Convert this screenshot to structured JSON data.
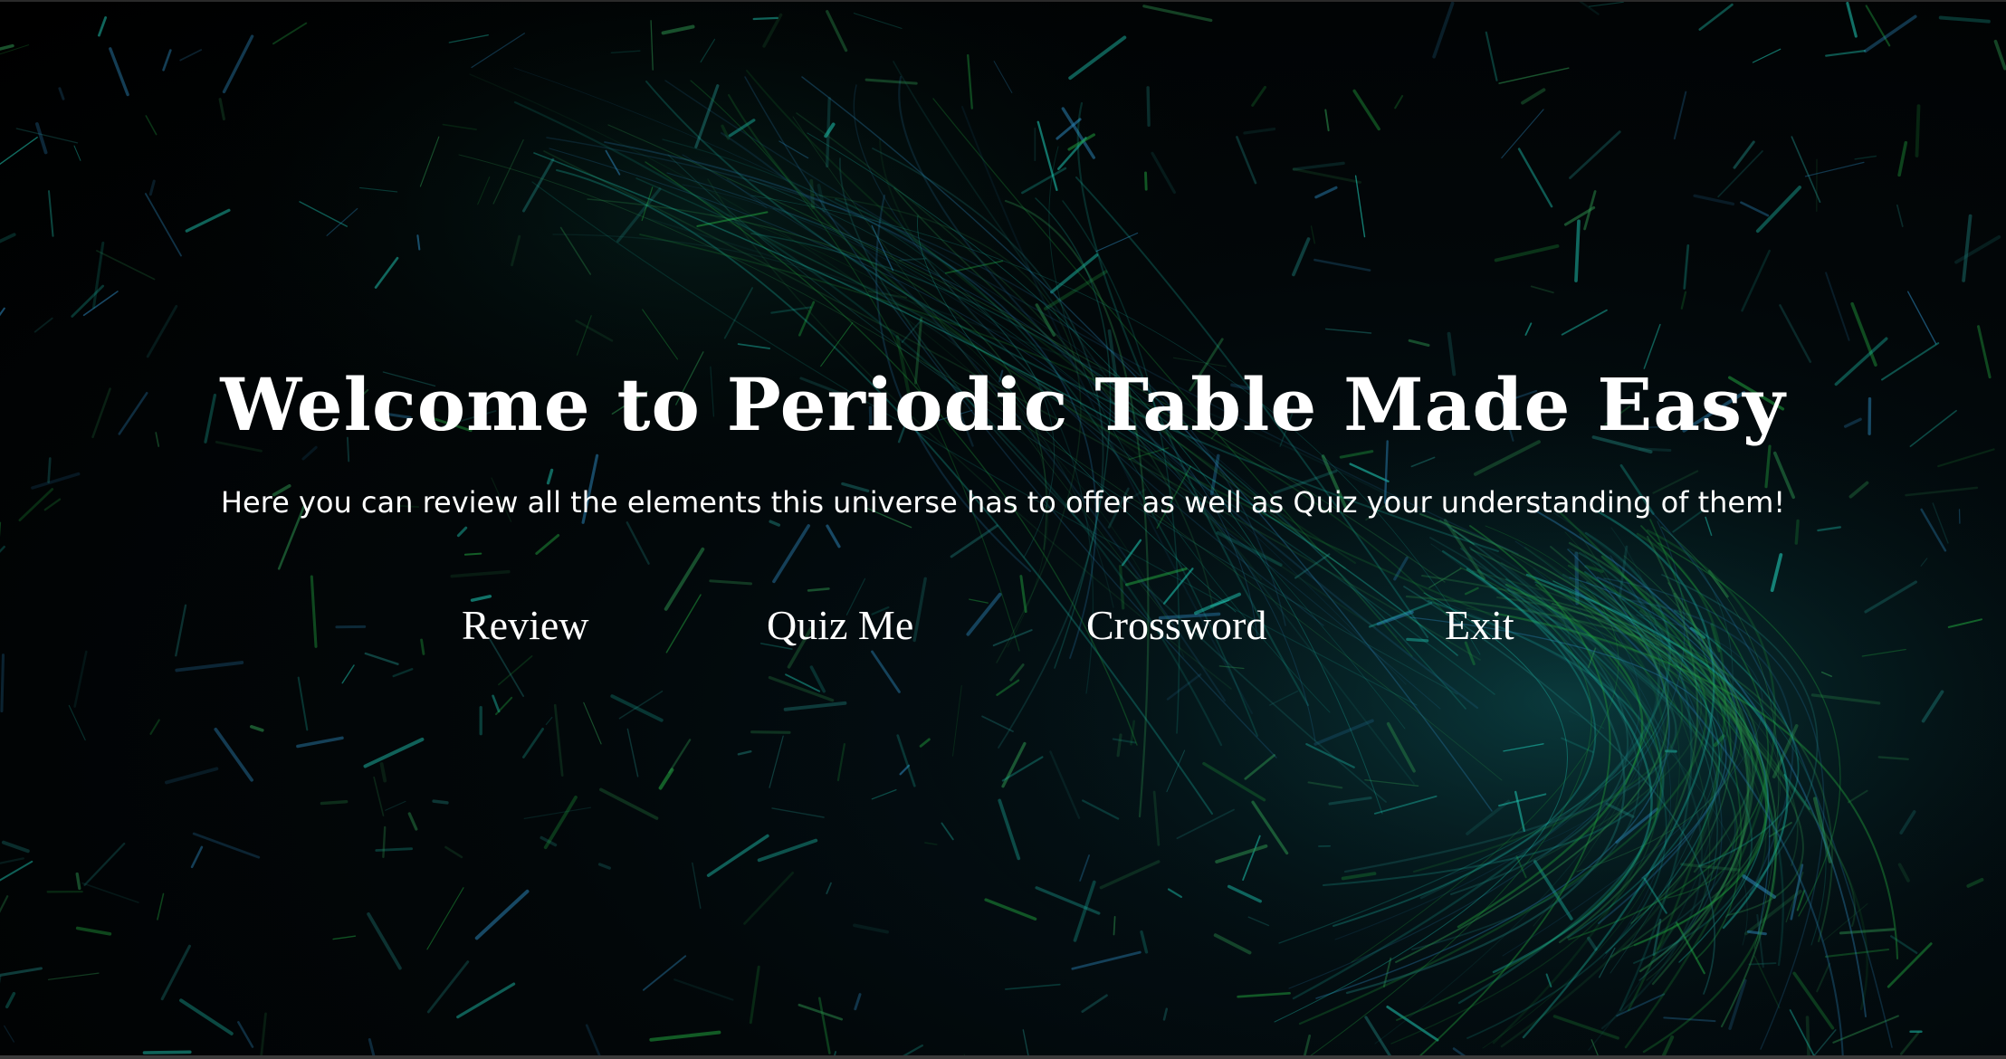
{
  "page": {
    "title": "Welcome to Periodic Table Made Easy",
    "subtitle": "Here you can review all the elements this universe has to offer as well as Quiz your understanding of them!"
  },
  "nav": {
    "review_label": "Review",
    "quiz_label": "Quiz Me",
    "crossword_label": "Crossword",
    "exit_label": "Exit"
  },
  "colors": {
    "background": "#000000",
    "text": "#ffffff",
    "particle_teal": "#1fc8b4",
    "particle_green": "#1f9a3c",
    "particle_blue": "#2a7fb0"
  }
}
